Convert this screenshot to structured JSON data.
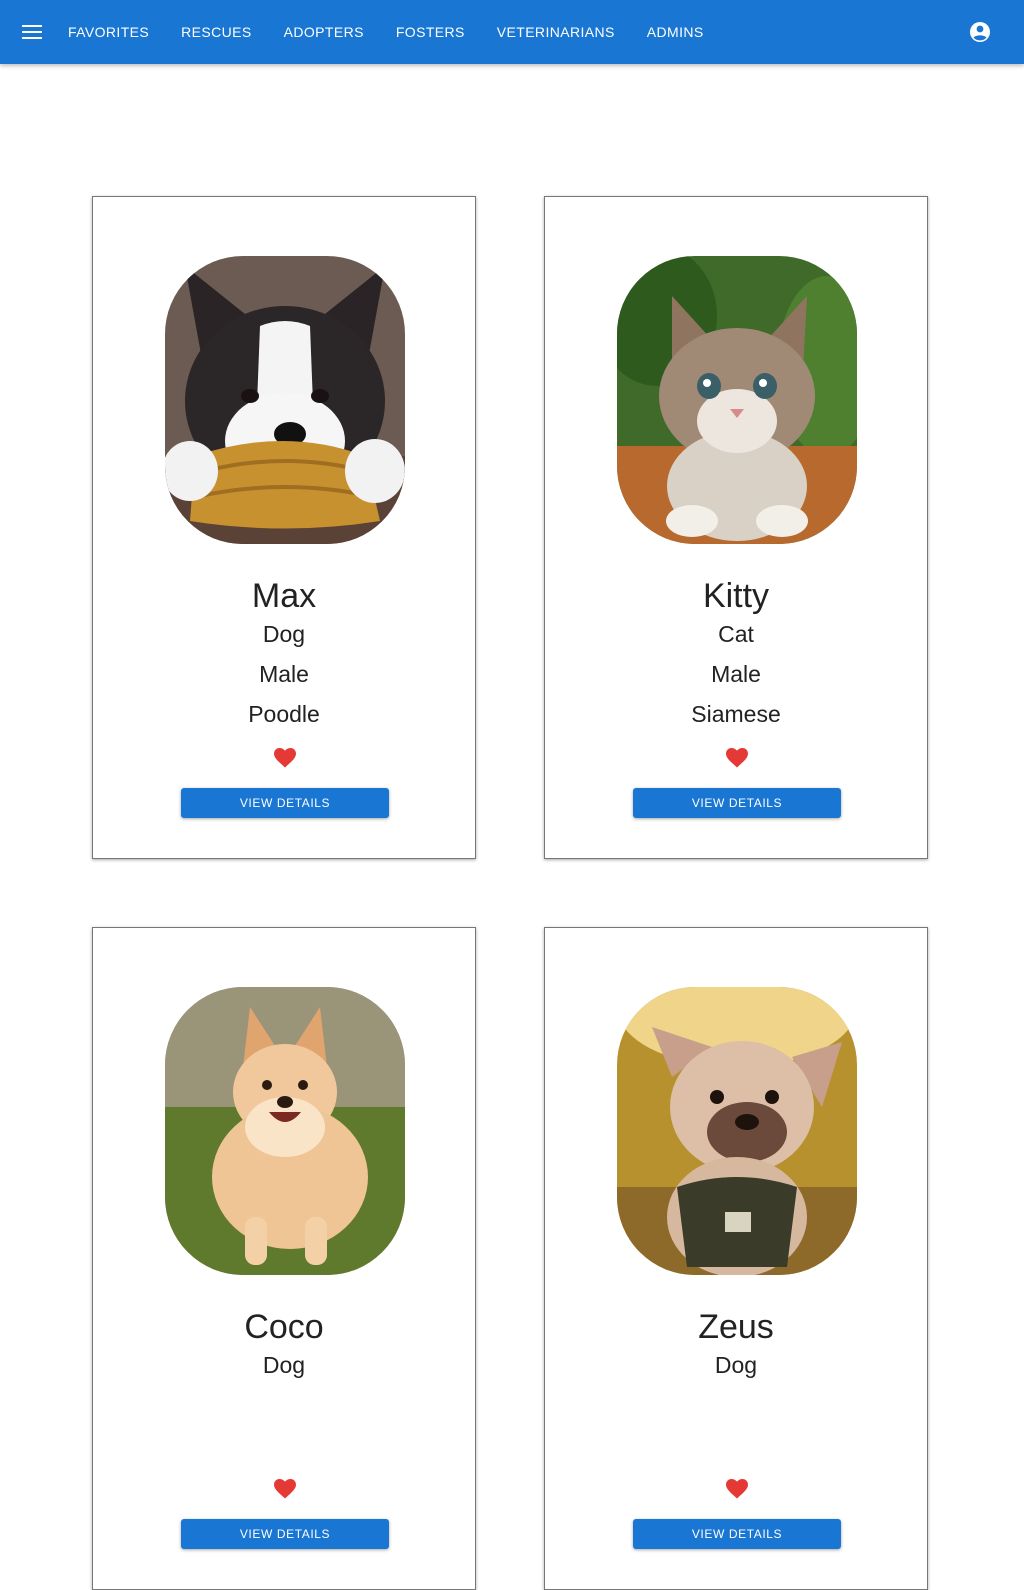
{
  "nav": {
    "items": [
      {
        "label": "FAVORITES"
      },
      {
        "label": "RESCUES"
      },
      {
        "label": "ADOPTERS"
      },
      {
        "label": "FOSTERS"
      },
      {
        "label": "VETERINARIANS"
      },
      {
        "label": "ADMINS"
      }
    ],
    "menu_icon": "menu-icon",
    "account_icon": "account-circle-icon"
  },
  "colors": {
    "primary": "#1976d2",
    "favorite": "#e53935"
  },
  "pets": [
    {
      "name": "Max",
      "species": "Dog",
      "sex": "Male",
      "breed": "Poodle",
      "favorite": true,
      "button": "VIEW DETAILS"
    },
    {
      "name": "Kitty",
      "species": "Cat",
      "sex": "Male",
      "breed": "Siamese",
      "favorite": true,
      "button": "VIEW DETAILS"
    },
    {
      "name": "Coco",
      "species": "Dog",
      "sex": "",
      "breed": "",
      "favorite": true,
      "button": "VIEW DETAILS"
    },
    {
      "name": "Zeus",
      "species": "Dog",
      "sex": "",
      "breed": "",
      "favorite": true,
      "button": "VIEW DETAILS"
    }
  ]
}
